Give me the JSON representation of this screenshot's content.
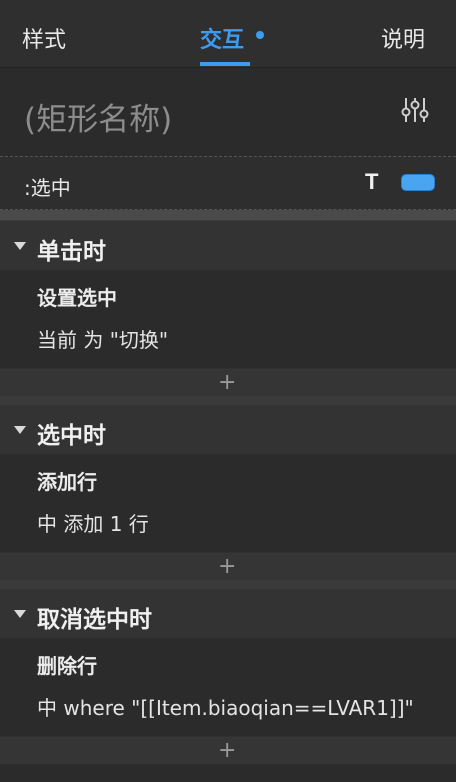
{
  "tabs": {
    "style": "样式",
    "interact": "交互",
    "notes": "说明"
  },
  "widget": {
    "name": "(矩形名称)"
  },
  "state": {
    "label": ":选中",
    "text_icon": "T",
    "chip_color": "#49a4f2"
  },
  "events": [
    {
      "title": "单击时",
      "action": "设置选中",
      "detail": "当前 为 \"切换\""
    },
    {
      "title": "选中时",
      "action": "添加行",
      "detail": "中 添加 1 行"
    },
    {
      "title": "取消选中时",
      "action": "删除行",
      "detail": "中 where \"[[Item.biaoqian==LVAR1]]\""
    }
  ],
  "add_symbol": "+",
  "colors": {
    "accent": "#3d9cf0",
    "background": "#2b2b2b"
  }
}
